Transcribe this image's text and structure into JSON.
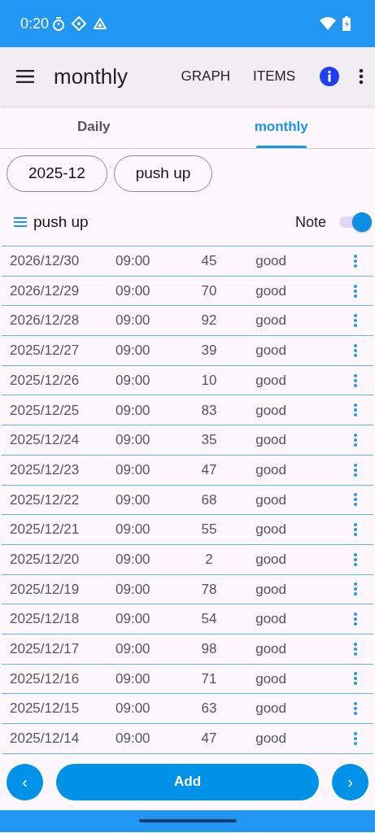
{
  "status_bar": {
    "time": "0:20"
  },
  "app_bar": {
    "title": "monthly",
    "actions": [
      "GRAPH",
      "ITEMS"
    ]
  },
  "tabs": [
    {
      "label": "Daily",
      "selected": false
    },
    {
      "label": "monthly",
      "selected": true
    }
  ],
  "filters": [
    "2025-12",
    "push up"
  ],
  "list_header": {
    "title": "push up",
    "note_label": "Note",
    "note_on": true
  },
  "rows": [
    {
      "date": "2026/12/30",
      "time": "09:00",
      "count": "45",
      "note": "good"
    },
    {
      "date": "2026/12/29",
      "time": "09:00",
      "count": "70",
      "note": "good"
    },
    {
      "date": "2026/12/28",
      "time": "09:00",
      "count": "92",
      "note": "good"
    },
    {
      "date": "2025/12/27",
      "time": "09:00",
      "count": "39",
      "note": "good"
    },
    {
      "date": "2025/12/26",
      "time": "09:00",
      "count": "10",
      "note": "good"
    },
    {
      "date": "2025/12/25",
      "time": "09:00",
      "count": "83",
      "note": "good"
    },
    {
      "date": "2025/12/24",
      "time": "09:00",
      "count": "35",
      "note": "good"
    },
    {
      "date": "2025/12/23",
      "time": "09:00",
      "count": "47",
      "note": "good"
    },
    {
      "date": "2025/12/22",
      "time": "09:00",
      "count": "68",
      "note": "good"
    },
    {
      "date": "2025/12/21",
      "time": "09:00",
      "count": "55",
      "note": "good"
    },
    {
      "date": "2025/12/20",
      "time": "09:00",
      "count": "2",
      "note": "good"
    },
    {
      "date": "2025/12/19",
      "time": "09:00",
      "count": "78",
      "note": "good"
    },
    {
      "date": "2025/12/18",
      "time": "09:00",
      "count": "54",
      "note": "good"
    },
    {
      "date": "2025/12/17",
      "time": "09:00",
      "count": "98",
      "note": "good"
    },
    {
      "date": "2025/12/16",
      "time": "09:00",
      "count": "71",
      "note": "good"
    },
    {
      "date": "2025/12/15",
      "time": "09:00",
      "count": "63",
      "note": "good"
    },
    {
      "date": "2025/12/14",
      "time": "09:00",
      "count": "47",
      "note": "good"
    }
  ],
  "bottom": {
    "prev": "‹",
    "add": "Add",
    "next": "›"
  }
}
